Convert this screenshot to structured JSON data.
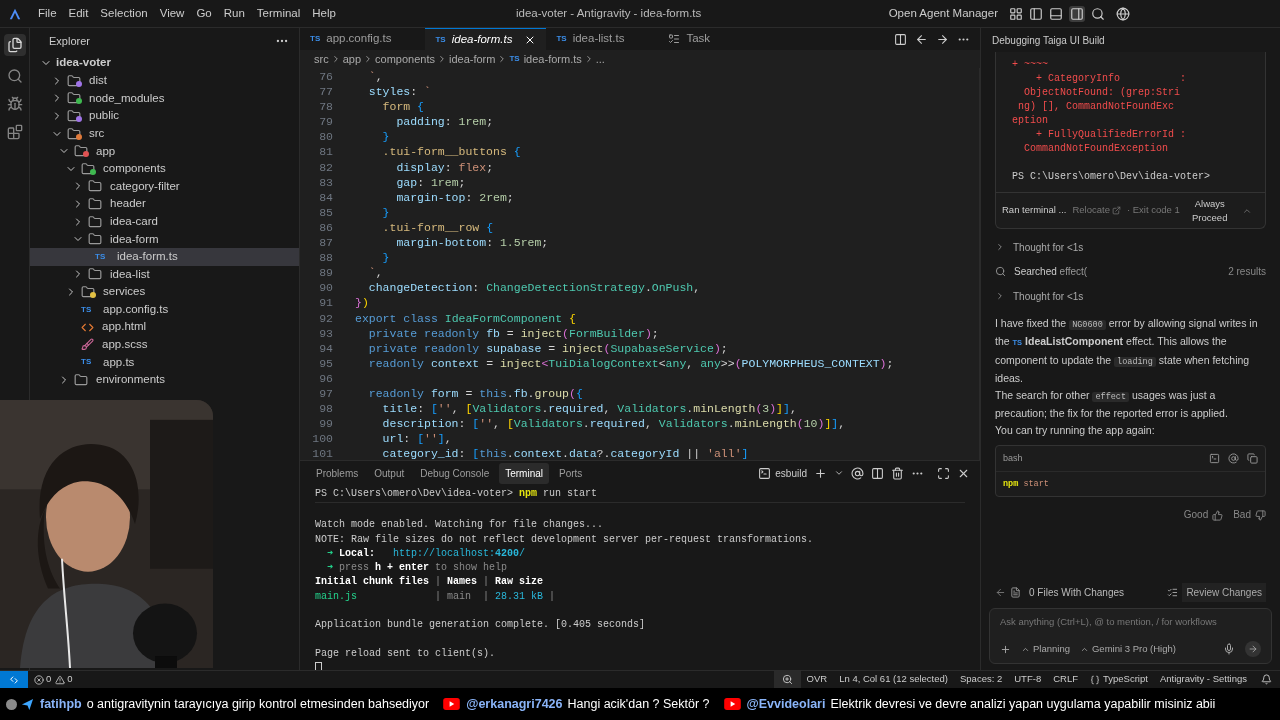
{
  "titlebar": {
    "menus": [
      "File",
      "Edit",
      "Selection",
      "View",
      "Go",
      "Run",
      "Terminal",
      "Help"
    ],
    "title": "idea-voter - Antigravity - idea-form.ts",
    "agent_manager": "Open Agent Manager"
  },
  "explorer": {
    "title": "Explorer",
    "root": {
      "label": "idea-voter",
      "expanded": true
    },
    "tree": [
      {
        "label": "dist",
        "kind": "folder",
        "expanded": false,
        "selected": false,
        "color": "#a074e8"
      },
      {
        "label": "node_modules",
        "kind": "folder",
        "expanded": false,
        "selected": false,
        "color": "#3fb950"
      },
      {
        "label": "public",
        "kind": "folder",
        "expanded": false,
        "selected": false,
        "color": "#a074e8"
      },
      {
        "label": "src",
        "kind": "folder",
        "expanded": true,
        "selected": false,
        "color": "#e07a3a",
        "children": [
          {
            "label": "app",
            "kind": "folder",
            "expanded": true,
            "selected": false,
            "color": "#e05252",
            "children": [
              {
                "label": "components",
                "kind": "folder",
                "expanded": true,
                "selected": false,
                "color": "#3fb950",
                "children": [
                  {
                    "label": "category-filter",
                    "kind": "folder",
                    "expanded": false,
                    "selected": false
                  },
                  {
                    "label": "header",
                    "kind": "folder",
                    "expanded": false,
                    "selected": false
                  },
                  {
                    "label": "idea-card",
                    "kind": "folder",
                    "expanded": false,
                    "selected": false
                  },
                  {
                    "label": "idea-form",
                    "kind": "folder",
                    "expanded": true,
                    "selected": false,
                    "children": [
                      {
                        "label": "idea-form.ts",
                        "kind": "ts",
                        "badge": "TS",
                        "selected": true
                      }
                    ]
                  },
                  {
                    "label": "idea-list",
                    "kind": "folder",
                    "expanded": false,
                    "selected": false
                  }
                ]
              },
              {
                "label": "services",
                "kind": "folder",
                "expanded": false,
                "selected": false,
                "color": "#e2c043"
              },
              {
                "label": "app.config.ts",
                "kind": "ts",
                "badge": "TS",
                "selected": false
              },
              {
                "label": "app.html",
                "kind": "html",
                "selected": false
              },
              {
                "label": "app.scss",
                "kind": "scss",
                "selected": false
              },
              {
                "label": "app.ts",
                "kind": "ts",
                "badge": "TS",
                "selected": false
              }
            ]
          },
          {
            "label": "environments",
            "kind": "folder",
            "expanded": false,
            "selected": false
          }
        ]
      }
    ]
  },
  "editor": {
    "tabs": [
      {
        "label": "app.config.ts",
        "badge": "TS",
        "kind": "file",
        "selected": false
      },
      {
        "label": "idea-form.ts",
        "badge": "TS",
        "kind": "file",
        "selected": true
      },
      {
        "label": "idea-list.ts",
        "badge": "TS",
        "kind": "file",
        "selected": false
      },
      {
        "label": "Task",
        "kind": "task",
        "selected": false
      }
    ],
    "breadcrumb": [
      {
        "label": "src"
      },
      {
        "label": "app"
      },
      {
        "label": "components"
      },
      {
        "label": "idea-form"
      },
      {
        "label": "idea-form.ts",
        "badge": "TS"
      },
      {
        "label": "..."
      }
    ],
    "lines": [
      {
        "n": "76",
        "seg": [
          {
            "t": "  `",
            "kind": "s"
          },
          {
            "t": ",",
            "kind": "p"
          }
        ]
      },
      {
        "n": "77",
        "seg": [
          {
            "t": "  styles",
            "kind": "v"
          },
          {
            "t": ": ",
            "kind": "p"
          },
          {
            "t": "`",
            "kind": "s"
          }
        ]
      },
      {
        "n": "78",
        "seg": [
          {
            "t": "    form",
            "kind": "sel"
          },
          {
            "t": " {",
            "kind": "b3"
          }
        ]
      },
      {
        "n": "79",
        "seg": [
          {
            "t": "      padding",
            "kind": "v"
          },
          {
            "t": ": ",
            "kind": "p"
          },
          {
            "t": "1rem",
            "kind": "n"
          },
          {
            "t": ";",
            "kind": "p"
          }
        ]
      },
      {
        "n": "80",
        "seg": [
          {
            "t": "    }",
            "kind": "b3"
          }
        ]
      },
      {
        "n": "81",
        "seg": [
          {
            "t": "    .tui-form__buttons",
            "kind": "sel"
          },
          {
            "t": " {",
            "kind": "b3"
          }
        ]
      },
      {
        "n": "82",
        "seg": [
          {
            "t": "      display",
            "kind": "v"
          },
          {
            "t": ": ",
            "kind": "p"
          },
          {
            "t": "flex",
            "kind": "s"
          },
          {
            "t": ";",
            "kind": "p"
          }
        ]
      },
      {
        "n": "83",
        "seg": [
          {
            "t": "      gap",
            "kind": "v"
          },
          {
            "t": ": ",
            "kind": "p"
          },
          {
            "t": "1rem",
            "kind": "n"
          },
          {
            "t": ";",
            "kind": "p"
          }
        ]
      },
      {
        "n": "84",
        "seg": [
          {
            "t": "      margin-top",
            "kind": "v"
          },
          {
            "t": ": ",
            "kind": "p"
          },
          {
            "t": "2rem",
            "kind": "n"
          },
          {
            "t": ";",
            "kind": "p"
          }
        ]
      },
      {
        "n": "85",
        "seg": [
          {
            "t": "    }",
            "kind": "b3"
          }
        ]
      },
      {
        "n": "86",
        "seg": [
          {
            "t": "    .tui-form__row",
            "kind": "sel"
          },
          {
            "t": " {",
            "kind": "b3"
          }
        ]
      },
      {
        "n": "87",
        "seg": [
          {
            "t": "      margin-bottom",
            "kind": "v"
          },
          {
            "t": ": ",
            "kind": "p"
          },
          {
            "t": "1.5rem",
            "kind": "n"
          },
          {
            "t": ";",
            "kind": "p"
          }
        ]
      },
      {
        "n": "88",
        "seg": [
          {
            "t": "    }",
            "kind": "b3"
          }
        ]
      },
      {
        "n": "89",
        "seg": [
          {
            "t": "  `",
            "kind": "s"
          },
          {
            "t": ",",
            "kind": "p"
          }
        ]
      },
      {
        "n": "90",
        "seg": [
          {
            "t": "  changeDetection",
            "kind": "v"
          },
          {
            "t": ": ",
            "kind": "p"
          },
          {
            "t": "ChangeDetectionStrategy",
            "kind": "t"
          },
          {
            "t": ".",
            "kind": "p"
          },
          {
            "t": "OnPush",
            "kind": "t"
          },
          {
            "t": ",",
            "kind": "p"
          }
        ]
      },
      {
        "n": "91",
        "seg": [
          {
            "t": "}",
            "kind": "b2"
          },
          {
            "t": ")",
            "kind": "b1"
          }
        ]
      },
      {
        "n": "92",
        "seg": [
          {
            "t": "export class",
            "kind": "k"
          },
          {
            "t": " IdeaFormComponent",
            "kind": "t"
          },
          {
            "t": " {",
            "kind": "b1"
          }
        ]
      },
      {
        "n": "93",
        "seg": [
          {
            "t": "  private readonly",
            "kind": "k"
          },
          {
            "t": " fb",
            "kind": "v"
          },
          {
            "t": " = ",
            "kind": "p"
          },
          {
            "t": "inject",
            "kind": "f"
          },
          {
            "t": "(",
            "kind": "b2"
          },
          {
            "t": "FormBuilder",
            "kind": "t"
          },
          {
            "t": ")",
            "kind": "b2"
          },
          {
            "t": ";",
            "kind": "p"
          }
        ]
      },
      {
        "n": "94",
        "seg": [
          {
            "t": "  private readonly",
            "kind": "k"
          },
          {
            "t": " supabase",
            "kind": "v"
          },
          {
            "t": " = ",
            "kind": "p"
          },
          {
            "t": "inject",
            "kind": "f"
          },
          {
            "t": "(",
            "kind": "b2"
          },
          {
            "t": "SupabaseService",
            "kind": "t"
          },
          {
            "t": ")",
            "kind": "b2"
          },
          {
            "t": ";",
            "kind": "p"
          }
        ]
      },
      {
        "n": "95",
        "seg": [
          {
            "t": "  readonly",
            "kind": "k"
          },
          {
            "t": " context",
            "kind": "v"
          },
          {
            "t": " = ",
            "kind": "p"
          },
          {
            "t": "inject",
            "kind": "f"
          },
          {
            "t": "<",
            "kind": "b2"
          },
          {
            "t": "TuiDialogContext",
            "kind": "t"
          },
          {
            "t": "<",
            "kind": "p"
          },
          {
            "t": "any",
            "kind": "t"
          },
          {
            "t": ", ",
            "kind": "p"
          },
          {
            "t": "any",
            "kind": "t"
          },
          {
            "t": ">>",
            "kind": "p"
          },
          {
            "t": "(",
            "kind": "b2"
          },
          {
            "t": "POLYMORPHEUS_CONTEXT",
            "kind": "v"
          },
          {
            "t": ")",
            "kind": "b2"
          },
          {
            "t": ";",
            "kind": "p"
          }
        ]
      },
      {
        "n": "96"
      },
      {
        "n": "97",
        "seg": [
          {
            "t": "  readonly",
            "kind": "k"
          },
          {
            "t": " form",
            "kind": "v"
          },
          {
            "t": " = ",
            "kind": "p"
          },
          {
            "t": "this",
            "kind": "k"
          },
          {
            "t": ".",
            "kind": "p"
          },
          {
            "t": "fb",
            "kind": "v"
          },
          {
            "t": ".",
            "kind": "p"
          },
          {
            "t": "group",
            "kind": "f"
          },
          {
            "t": "(",
            "kind": "b2"
          },
          {
            "t": "{",
            "kind": "b3"
          }
        ]
      },
      {
        "n": "98",
        "seg": [
          {
            "t": "    title",
            "kind": "v"
          },
          {
            "t": ": ",
            "kind": "p"
          },
          {
            "t": "[",
            "kind": "b3"
          },
          {
            "t": "''",
            "kind": "s"
          },
          {
            "t": ", ",
            "kind": "p"
          },
          {
            "t": "[",
            "kind": "b1"
          },
          {
            "t": "Validators",
            "kind": "t"
          },
          {
            "t": ".",
            "kind": "p"
          },
          {
            "t": "required",
            "kind": "v"
          },
          {
            "t": ", ",
            "kind": "p"
          },
          {
            "t": "Validators",
            "kind": "t"
          },
          {
            "t": ".",
            "kind": "p"
          },
          {
            "t": "minLength",
            "kind": "f"
          },
          {
            "t": "(",
            "kind": "b2"
          },
          {
            "t": "3",
            "kind": "n"
          },
          {
            "t": ")",
            "kind": "b2"
          },
          {
            "t": "]",
            "kind": "b1"
          },
          {
            "t": "]",
            "kind": "b3"
          },
          {
            "t": ",",
            "kind": "p"
          }
        ]
      },
      {
        "n": "99",
        "seg": [
          {
            "t": "    description",
            "kind": "v"
          },
          {
            "t": ": ",
            "kind": "p"
          },
          {
            "t": "[",
            "kind": "b3"
          },
          {
            "t": "''",
            "kind": "s"
          },
          {
            "t": ", ",
            "kind": "p"
          },
          {
            "t": "[",
            "kind": "b1"
          },
          {
            "t": "Validators",
            "kind": "t"
          },
          {
            "t": ".",
            "kind": "p"
          },
          {
            "t": "required",
            "kind": "v"
          },
          {
            "t": ", ",
            "kind": "p"
          },
          {
            "t": "Validators",
            "kind": "t"
          },
          {
            "t": ".",
            "kind": "p"
          },
          {
            "t": "minLength",
            "kind": "f"
          },
          {
            "t": "(",
            "kind": "b2"
          },
          {
            "t": "10",
            "kind": "n"
          },
          {
            "t": ")",
            "kind": "b2"
          },
          {
            "t": "]",
            "kind": "b1"
          },
          {
            "t": "]",
            "kind": "b3"
          },
          {
            "t": ",",
            "kind": "p"
          }
        ]
      },
      {
        "n": "100",
        "seg": [
          {
            "t": "    url",
            "kind": "v"
          },
          {
            "t": ": ",
            "kind": "p"
          },
          {
            "t": "[",
            "kind": "b3"
          },
          {
            "t": "''",
            "kind": "s"
          },
          {
            "t": "]",
            "kind": "b3"
          },
          {
            "t": ",",
            "kind": "p"
          }
        ]
      },
      {
        "n": "101",
        "seg": [
          {
            "t": "    category_id",
            "kind": "v"
          },
          {
            "t": ": ",
            "kind": "p"
          },
          {
            "t": "[",
            "kind": "b3"
          },
          {
            "t": "this",
            "kind": "k"
          },
          {
            "t": ".",
            "kind": "p"
          },
          {
            "t": "context",
            "kind": "v"
          },
          {
            "t": ".",
            "kind": "p"
          },
          {
            "t": "data",
            "kind": "v"
          },
          {
            "t": "?.",
            "kind": "p"
          },
          {
            "t": "categoryId",
            "kind": "v"
          },
          {
            "t": " || ",
            "kind": "p"
          },
          {
            "t": "'all'",
            "kind": "s"
          },
          {
            "t": "]",
            "kind": "b3"
          }
        ]
      }
    ]
  },
  "panel": {
    "tabs": [
      {
        "label": "Problems",
        "selected": false
      },
      {
        "label": "Output",
        "selected": false
      },
      {
        "label": "Debug Console",
        "selected": false
      },
      {
        "label": "Terminal",
        "selected": true
      },
      {
        "label": "Ports",
        "selected": false
      }
    ],
    "terminal_name": "esbuild",
    "prompt": [
      {
        "t": "PS C:\\Users\\omero\\Dev\\idea-voter> ",
        "kind": "p"
      },
      {
        "t": "npm",
        "kind": "y"
      },
      {
        "t": " run start",
        "kind": "p"
      }
    ],
    "lines": [
      {
        "space": true,
        "seg": [
          {
            "t": "Watch mode enabled. Watching for file changes...",
            "kind": "p"
          }
        ]
      },
      {
        "space": false,
        "seg": [
          {
            "t": "NOTE: Raw file sizes do not reflect development server per-request transformations.",
            "kind": "p"
          }
        ]
      },
      {
        "space": false,
        "seg": [
          {
            "t": "  ➜ ",
            "kind": "g"
          },
          {
            "t": "Local:",
            "kind": "b"
          },
          {
            "t": "   http://localhost:",
            "kind": "c"
          },
          {
            "t": "4200",
            "kind": "cb"
          },
          {
            "t": "/",
            "kind": "c"
          }
        ]
      },
      {
        "space": false,
        "seg": [
          {
            "t": "  ➜ ",
            "kind": "g"
          },
          {
            "t": "press ",
            "kind": "d"
          },
          {
            "t": "h + enter",
            "kind": "b"
          },
          {
            "t": " to show help",
            "kind": "d"
          }
        ]
      },
      {
        "space": false,
        "seg": [
          {
            "t": "Initial chunk files",
            "kind": "b"
          },
          {
            "t": " | ",
            "kind": "d"
          },
          {
            "t": "Names",
            "kind": "b"
          },
          {
            "t": " | ",
            "kind": "d"
          },
          {
            "t": "Raw size",
            "kind": "b"
          }
        ]
      },
      {
        "space": false,
        "seg": [
          {
            "t": "main.js",
            "kind": "g"
          },
          {
            "t": "             | main  | ",
            "kind": "d"
          },
          {
            "t": "28.31 kB",
            "kind": "c"
          },
          {
            "t": " |",
            "kind": "d"
          }
        ]
      },
      {
        "space": true,
        "seg": [
          {
            "t": "Application bundle generation complete. [0.405 seconds]",
            "kind": "p"
          }
        ]
      },
      {
        "space": true,
        "seg": [
          {
            "t": "Page reload sent to client(s).",
            "kind": "p"
          }
        ]
      }
    ]
  },
  "agent": {
    "title": "Debugging Taiga UI Build",
    "output": [
      {
        "t": "+ ~~~~",
        "kind": "r",
        "space": false
      },
      {
        "t": "    + CategoryInfo          :",
        "kind": "r",
        "space": false
      },
      {
        "t": "  ObjectNotFound: (grep:Stri",
        "kind": "r",
        "space": false
      },
      {
        "t": " ng) [], CommandNotFoundExc",
        "kind": "r",
        "space": false
      },
      {
        "t": "eption",
        "kind": "r",
        "space": false
      },
      {
        "t": "    + FullyQualifiedErrorId :",
        "kind": "r",
        "space": false
      },
      {
        "t": "  CommandNotFoundException",
        "kind": "r",
        "space": false
      },
      {
        "t": "PS C:\\Users\\omero\\Dev\\idea-voter>",
        "kind": "w",
        "space": true
      }
    ],
    "run": {
      "label": "Ran terminal ...",
      "relocate": "Relocate",
      "exit": "· Exit code 1",
      "action": "Always Proceed"
    },
    "steps": [
      {
        "kind": "thought",
        "label": "Thought for <1s"
      },
      {
        "kind": "search",
        "label": "Searched",
        "query": "effect(",
        "count": "2 results"
      },
      {
        "kind": "thought",
        "label": "Thought for <1s"
      }
    ],
    "message": [
      [
        {
          "kind": "text",
          "t": "I have fixed the "
        },
        {
          "kind": "code",
          "t": "NG0600"
        },
        {
          "kind": "text",
          "t": " error by allowing signal writes in the "
        },
        {
          "kind": "ref",
          "icon": "TS",
          "t": "IdeaListComponent"
        },
        {
          "kind": "text",
          "t": " effect. This allows the component to update the "
        },
        {
          "kind": "code",
          "t": "loading"
        },
        {
          "kind": "text",
          "t": " state when fetching ideas."
        }
      ],
      [
        {
          "kind": "text",
          "t": "The search for other "
        },
        {
          "kind": "code",
          "t": "effect"
        },
        {
          "kind": "text",
          "t": " usages was just a precaution; the fix for the reported error is applied."
        }
      ],
      [
        {
          "kind": "text",
          "t": "You can try running the app again:"
        }
      ]
    ],
    "code_block": {
      "lang": "bash",
      "seg": [
        {
          "t": "npm",
          "kind": "y"
        },
        {
          "t": " start",
          "kind": "s"
        }
      ]
    },
    "feedback": {
      "good": "Good",
      "bad": "Bad"
    },
    "changes": {
      "label": "0 Files With Changes",
      "review": "Review Changes"
    },
    "input": {
      "placeholder": "Ask anything (Ctrl+L), @ to mention, / for workflows",
      "mode": "Planning",
      "model": "Gemini 3 Pro (High)"
    }
  },
  "status_bar": {
    "errors": "0",
    "warnings": "0",
    "items": [
      {
        "kind": "text",
        "label": "OVR"
      },
      {
        "kind": "text",
        "label": "Ln 4, Col 61 (12 selected)"
      },
      {
        "kind": "text",
        "label": "Spaces: 2"
      },
      {
        "kind": "text",
        "label": "UTF-8"
      },
      {
        "kind": "text",
        "label": "CRLF"
      },
      {
        "kind": "lang",
        "label": "TypeScript"
      },
      {
        "kind": "text",
        "label": "Antigravity - Settings"
      }
    ]
  },
  "ticker": [
    {
      "kind": "plane",
      "user": "fatihpb",
      "text": "o antigravitynin tarayıcıya girip kontrol etmesinden bahsediyor"
    },
    {
      "kind": "youtube",
      "user": "@erkanagri7426",
      "text": "Hangi acik'dan ? Sektör ?"
    },
    {
      "kind": "youtube",
      "user": "@Evvideolari",
      "text": "Elektrik devresi ve devre analizi yapan uygulama yapabilir misiniz abii"
    }
  ]
}
